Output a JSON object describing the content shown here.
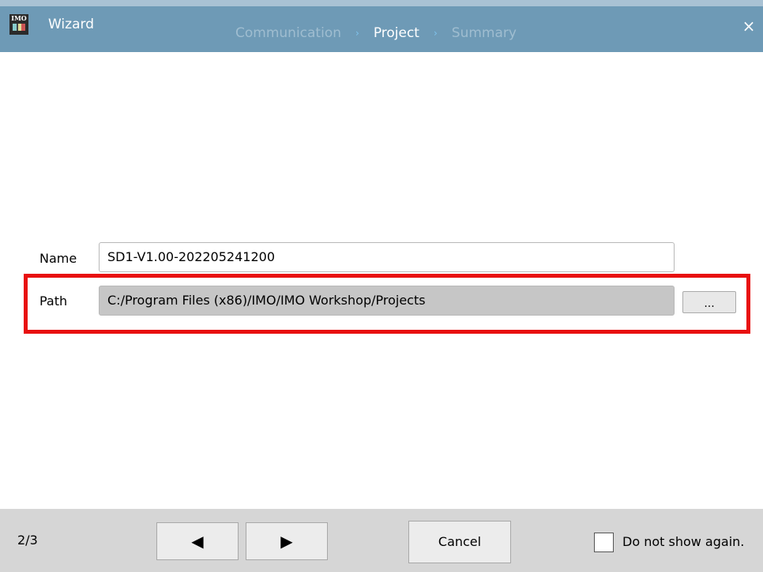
{
  "window": {
    "title": "Wizard",
    "app_icon_text": "IMO",
    "close_glyph": "×",
    "accent": "#6e9ab6"
  },
  "steps": [
    {
      "label": "Communication",
      "state": "done"
    },
    {
      "label": "Project",
      "state": "current"
    },
    {
      "label": "Summary",
      "state": "upcoming"
    }
  ],
  "step_separator": "›",
  "form": {
    "name_label": "Name",
    "name_value": "SD1-V1.00-202205241200",
    "path_label": "Path",
    "path_value": "C:/Program Files (x86)/IMO/IMO Workshop/Projects",
    "browse_label": "..."
  },
  "highlight_color": "#e81010",
  "footer": {
    "page_indicator": "2/3",
    "prev_glyph": "◀",
    "next_glyph": "▶",
    "cancel_label": "Cancel",
    "dont_show_label": "Do not show again.",
    "dont_show_checked": false
  }
}
